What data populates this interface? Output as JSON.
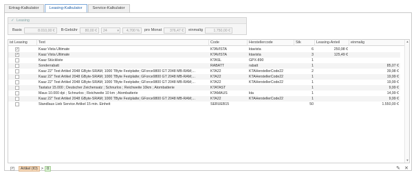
{
  "tabs": [
    {
      "label": "Ertrag-Kalkulator"
    },
    {
      "label": "Leasing-Kalkulator"
    },
    {
      "label": "Service-Kalkulator"
    }
  ],
  "leasing": {
    "group_title": "Leasing",
    "basis_label": "Basis",
    "basis_value": "8.010,00 €",
    "bgebuehr_label": "B-Gebühr",
    "bgebuehr_value": "80,00 €",
    "months_value": "24",
    "rate_value": "4,700 %",
    "pro_monat_label": "pro Monat",
    "pro_monat_value": "376,47 €",
    "einmalig_label": "einmalig",
    "einmalig_value": "1.750,00 €"
  },
  "grid": {
    "columns": [
      "ist Leasing",
      "Text",
      "Code",
      "Herstellercode",
      "Stk",
      "Leasing-Anteil",
      "einmalig"
    ],
    "rows": [
      {
        "checked": true,
        "text": "Kaaz Vista Ultimate",
        "code": "KTAVISTA",
        "hcode": "ktavista",
        "stk": "6",
        "anteil": "250,98 €",
        "einmalig": ""
      },
      {
        "checked": true,
        "text": "Kaaz Vista Ultimate",
        "code": "KTAVISTA",
        "hcode": "ktavista",
        "stk": "3",
        "anteil": "125,49 €",
        "einmalig": ""
      },
      {
        "checked": false,
        "text": "Kaaz Stückliste",
        "code": "KTASL",
        "hcode": "GPX-890",
        "stk": "1",
        "anteil": "",
        "einmalig": ""
      },
      {
        "checked": false,
        "text": "Sonderrabatt",
        "code": "RABATT",
        "hcode": "rabatt",
        "stk": "1",
        "anteil": "",
        "einmalig": "85,07 €"
      },
      {
        "checked": false,
        "text": "Kaaz 22\" Test Artikel 2048 GByte-SRAM; 1000 TByte Festplatte; GForce9800 GT 2048 MB-RAM;...",
        "code": "KTA22",
        "hcode": "KTAHerstellerCode22",
        "stk": "2",
        "anteil": "",
        "einmalig": "39,98 €"
      },
      {
        "checked": false,
        "text": "Kaaz 22\" Test Artikel 2048 GByte-SRAM; 1000 TByte Festplatte; GForce9800 GT 2048 MB-RAM;...",
        "code": "KTA22",
        "hcode": "KTAHerstellerCode22",
        "stk": "1",
        "anteil": "",
        "einmalig": "19,99 €"
      },
      {
        "checked": false,
        "text": "Kaaz 22\" Test Artikel 2048 GByte-SRAM; 1000 TByte Festplatte; GForce9800 GT 2048 MB-RAM;...",
        "code": "KTA22",
        "hcode": "KTAHerstellerCode22",
        "stk": "1",
        "anteil": "",
        "einmalig": "19,99 €"
      },
      {
        "checked": false,
        "text": "Tastatur 15.000 ; Deutscher Zeichensatz ; Schnurlos ; Reichweite 10km ; Atombatterie",
        "code": "KTATAST",
        "hcode": "",
        "stk": "1",
        "anteil": "",
        "einmalig": "9,99 €"
      },
      {
        "checked": false,
        "text": "Maus 10.000 dpi ; Schnurlos ; Reichweite 10 km ; Atombatterie",
        "code": "KTAMAUS",
        "hcode": "kta",
        "stk": "1",
        "anteil": "",
        "einmalig": "14,99 €"
      },
      {
        "checked": false,
        "text": "Kaaz 22\" Test Artikel 2048 GByte-SRAM; 1000 TByte Festplatte; GForce9800 GT 2048 MB-RAM;...",
        "code": "KTA22",
        "hcode": "KTAHerstellerCode22",
        "stk": "1",
        "anteil": "",
        "einmalig": "9,99 €"
      },
      {
        "checked": false,
        "text": "Standlaus Lieb Service Artikel 15 min. Einheit",
        "code": "SERUEB15",
        "hcode": "",
        "stk": "50",
        "anteil": "",
        "einmalig": "1.550,00 €"
      }
    ]
  },
  "filter": {
    "field": "Artikel (IO)",
    "operator": ">",
    "value": "0"
  },
  "icons": {
    "check": "check-icon",
    "edit": "pencil-icon",
    "close": "close-icon",
    "arrow_up": "scroll-up-icon",
    "arrow_down": "scroll-down-icon"
  }
}
